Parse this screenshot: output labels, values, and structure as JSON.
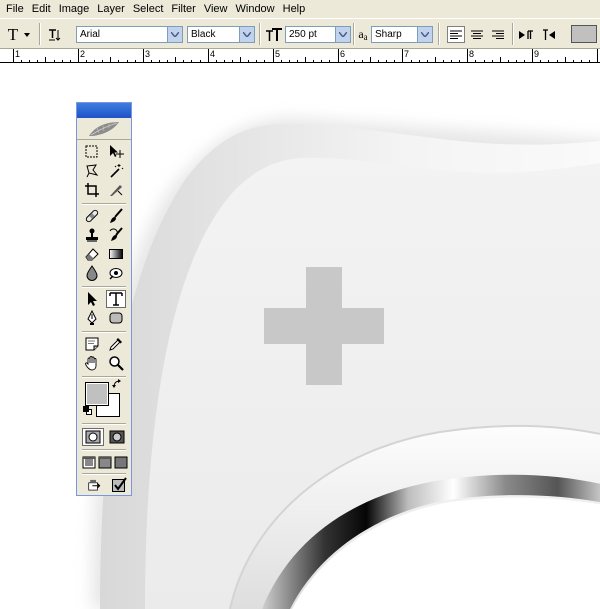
{
  "menu": [
    "File",
    "Edit",
    "Image",
    "Layer",
    "Select",
    "Filter",
    "View",
    "Window",
    "Help"
  ],
  "options": {
    "tool_glyph": "T",
    "font_family": "Arial",
    "font_style": "Black",
    "font_size": "250 pt",
    "antialias_glyph": "a",
    "antialias_glyph_small": "a",
    "antialias": "Sharp",
    "text_color": "#c0c0c0"
  },
  "ruler": {
    "labels": [
      "1",
      "2",
      "3",
      "4",
      "5",
      "6",
      "7",
      "8",
      "9"
    ]
  },
  "toolbox": {
    "fg_color": "#c0c0c0",
    "bg_color": "#ffffff"
  },
  "icons": {
    "tool_preset": "type-tool-icon",
    "orientation": "text-orientation-icon",
    "size": "font-size-icon",
    "antialias": "antialias-icon",
    "align_left": "align-left-icon",
    "align_center": "align-center-icon",
    "align_right": "align-right-icon",
    "warp": "warp-text-icon",
    "palettes": "palettes-icon"
  },
  "canvas": {
    "cross_color": "#c8c8c8"
  }
}
